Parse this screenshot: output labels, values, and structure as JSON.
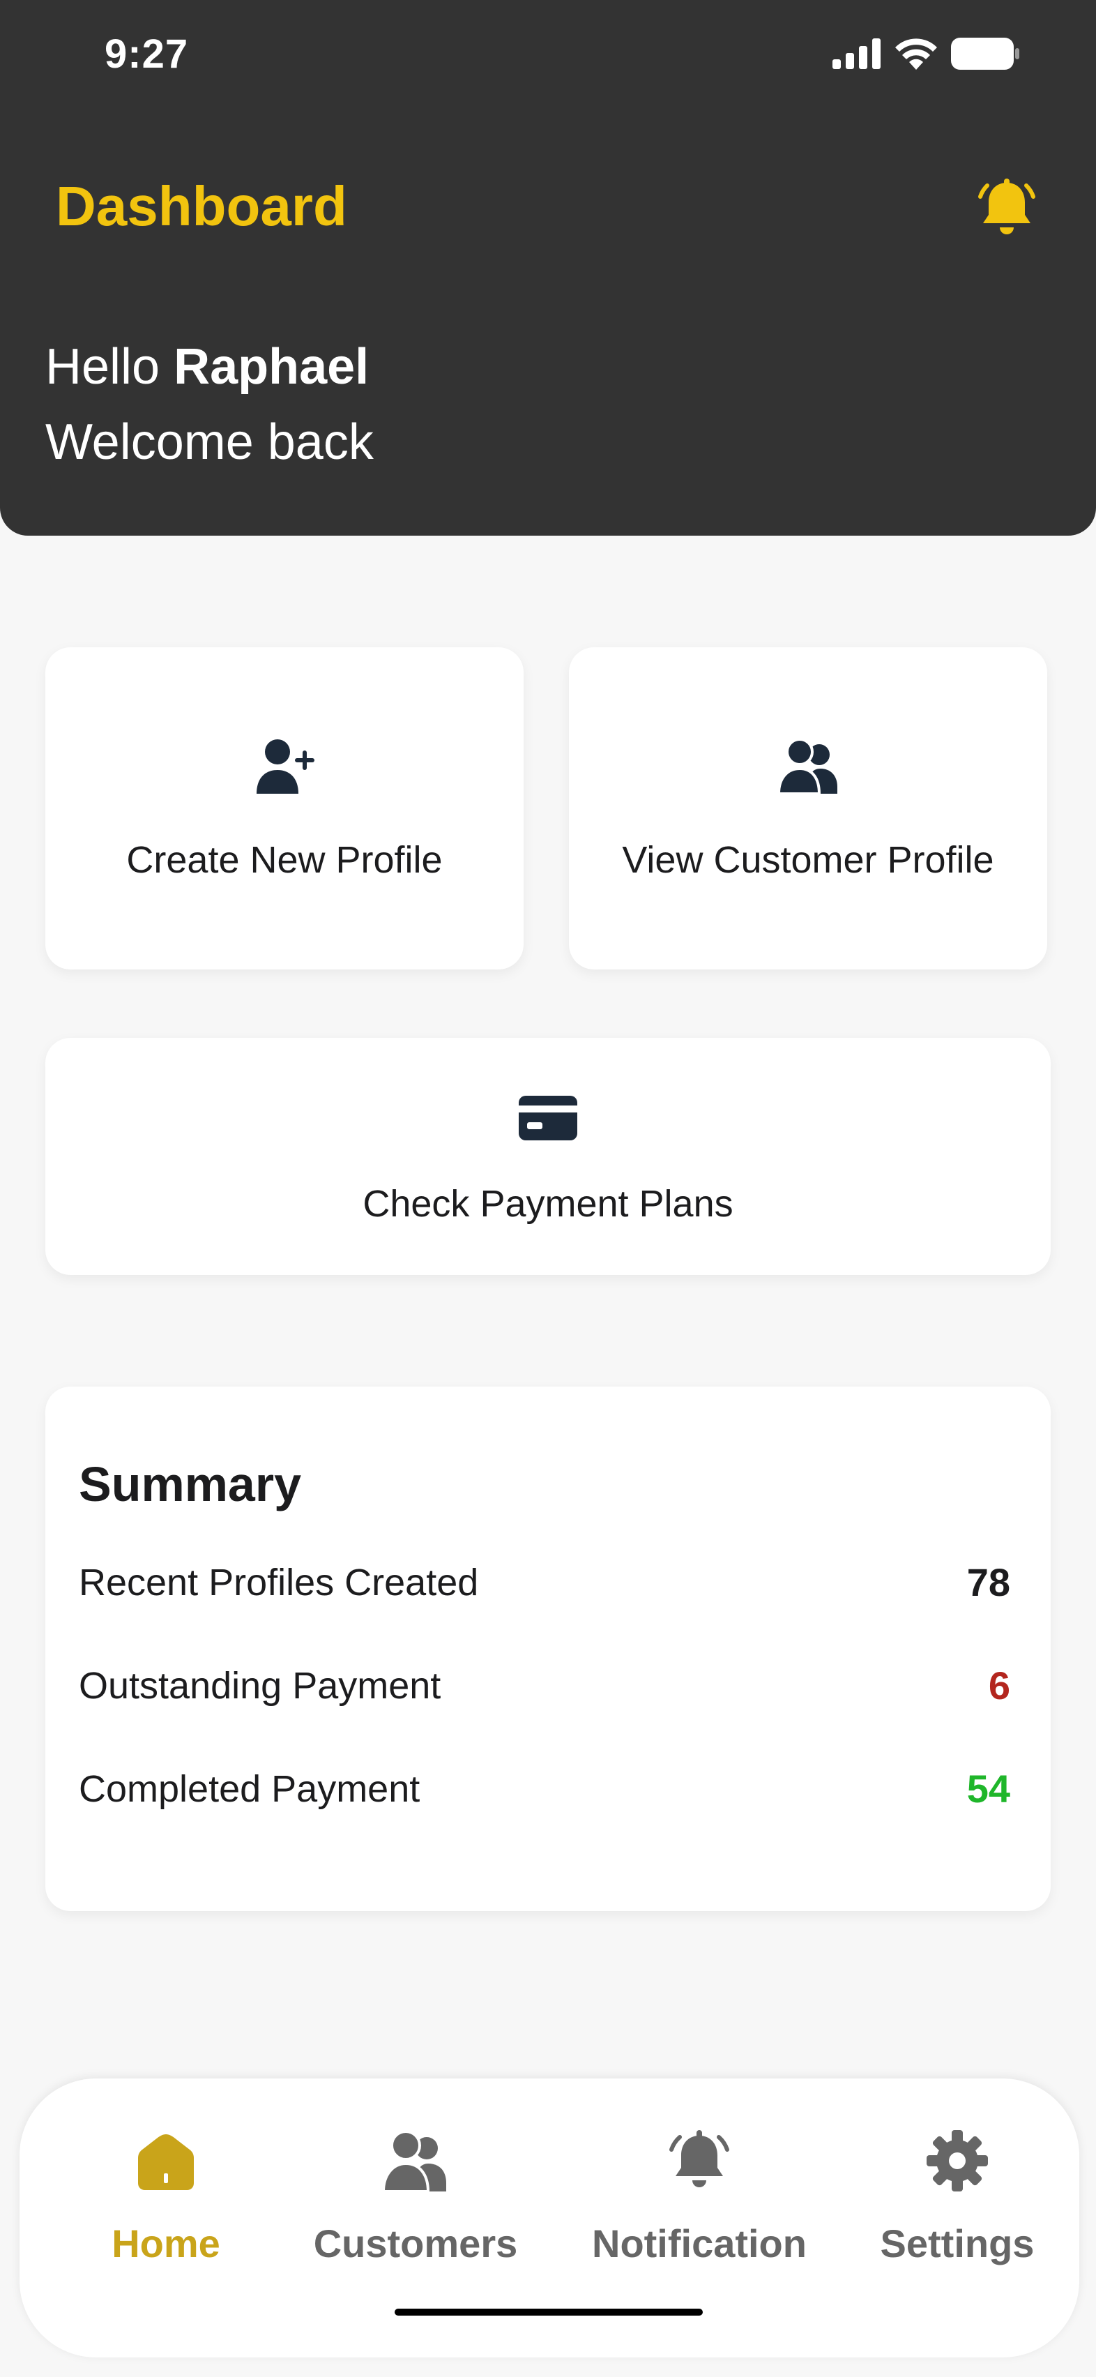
{
  "status_bar": {
    "time": "9:27"
  },
  "header": {
    "title": "Dashboard",
    "greeting_prefix": "Hello ",
    "user_name": "Raphael",
    "welcome": "Welcome back"
  },
  "actions": {
    "create_profile": {
      "label": "Create New Profile",
      "icon": "user-plus-icon"
    },
    "view_profile": {
      "label": "View Customer Profile",
      "icon": "users-icon"
    },
    "payment_plans": {
      "label": "Check Payment Plans",
      "icon": "credit-card-icon"
    }
  },
  "summary": {
    "title": "Summary",
    "rows": [
      {
        "label": "Recent Profiles Created",
        "value": "78",
        "color": "#1c1c1e"
      },
      {
        "label": "Outstanding Payment",
        "value": "6",
        "color": "#b3261e"
      },
      {
        "label": "Completed Payment",
        "value": "54",
        "color": "#1fb62a"
      }
    ]
  },
  "bottom_nav": {
    "items": [
      {
        "label": "Home",
        "icon": "home-icon",
        "active": true
      },
      {
        "label": "Customers",
        "icon": "users-icon",
        "active": false
      },
      {
        "label": "Notification",
        "icon": "bell-icon",
        "active": false
      },
      {
        "label": "Settings",
        "icon": "gear-icon",
        "active": false
      }
    ]
  },
  "colors": {
    "accent": "#f2c40f",
    "header_bg": "#333333",
    "active_nav": "#c9a41a",
    "inactive_nav": "#666666"
  }
}
